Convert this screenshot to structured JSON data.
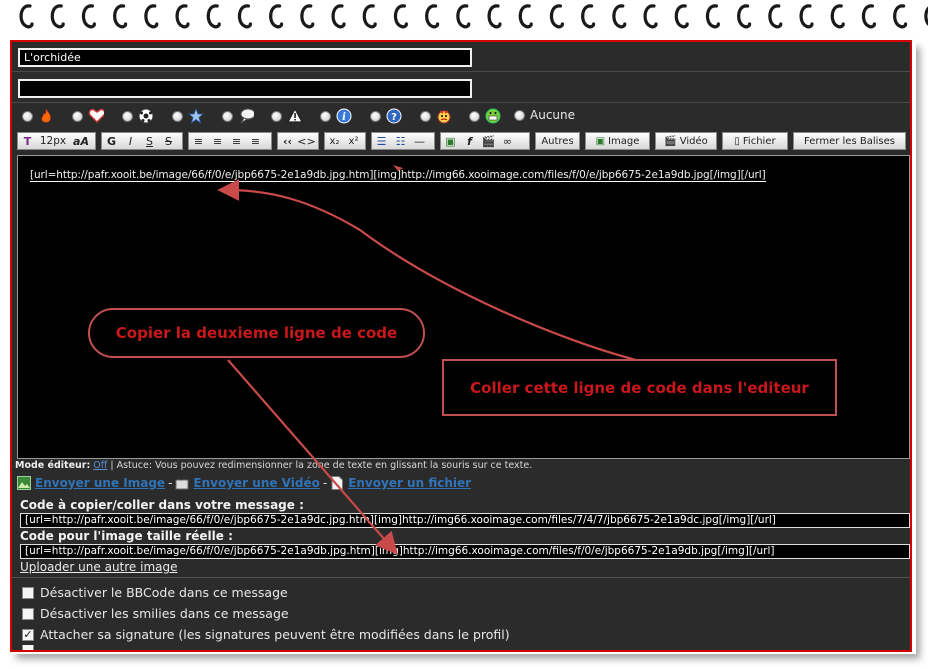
{
  "form": {
    "title_value": "L'orchidée",
    "subtitle_value": ""
  },
  "icons": {
    "options": [
      "flame-icon",
      "heart-icon",
      "soccer-ball-icon",
      "star-icon",
      "speech-bubble-icon",
      "warning-icon",
      "info-icon",
      "question-icon",
      "angry-face-icon",
      "grin-face-icon"
    ],
    "none_label": "Aucune"
  },
  "toolbar": {
    "font_size": "12px",
    "font_style": "aA",
    "bold": "G",
    "italic": "I",
    "underline": "S",
    "strike": "S",
    "quote": "‹‹",
    "code": "<>",
    "sub": "x₂",
    "sup": "x²",
    "other_label": "Autres",
    "image_label": "Image",
    "video_label": "Vidéo",
    "file_label": "Fichier",
    "close_tags_label": "Fermer les Balises"
  },
  "editor": {
    "content": "[url=http://pafr.xooit.be/image/66/f/0/e/jbp6675-2e1a9db.jpg.htm][img]http://img66.xooimage.com/files/f/0/e/jbp6675-2e1a9db.jpg[/img][/url]"
  },
  "mode": {
    "label": "Mode éditeur:",
    "off": "Off",
    "tip": "| Astuce: Vous pouvez redimensionner la zone de texte en glissant la souris sur ce texte."
  },
  "send": {
    "image": "Envoyer une Image",
    "video": "Envoyer une Vidéo",
    "file": "Envoyer un fichier",
    "separator": "-"
  },
  "codes": {
    "copy_label": "Code à copier/coller dans votre message :",
    "copy_value": "[url=http://pafr.xooit.be/image/66/f/0/e/jbp6675-2e1a9dc.jpg.htm][img]http://img66.xooimage.com/files/7/4/7/jbp6675-2e1a9dc.jpg[/img][/url]",
    "real_label": "Code pour l'image taille réelle :",
    "real_value": "[url=http://pafr.xooit.be/image/66/f/0/e/jbp6675-2e1a9db.jpg.htm][img]http://img66.xooimage.com/files/f/0/e/jbp6675-2e1a9db.jpg[/img][/url]",
    "upload_other": "Uploader une autre image"
  },
  "options": [
    {
      "label": "Désactiver le BBCode dans ce message",
      "checked": false
    },
    {
      "label": "Désactiver les smilies dans ce message",
      "checked": false
    },
    {
      "label": "Attacher sa signature (les signatures peuvent être modifiées dans le profil)",
      "checked": true
    }
  ],
  "annotations": {
    "copy_note": "Copier la deuxieme ligne de code",
    "paste_note": "Coller cette ligne de code dans l'editeur"
  },
  "colors": {
    "frame_border": "#d40000",
    "panel_bg": "#2b2b2b",
    "annotation_text": "#c8181c",
    "link": "#2f73b8"
  }
}
